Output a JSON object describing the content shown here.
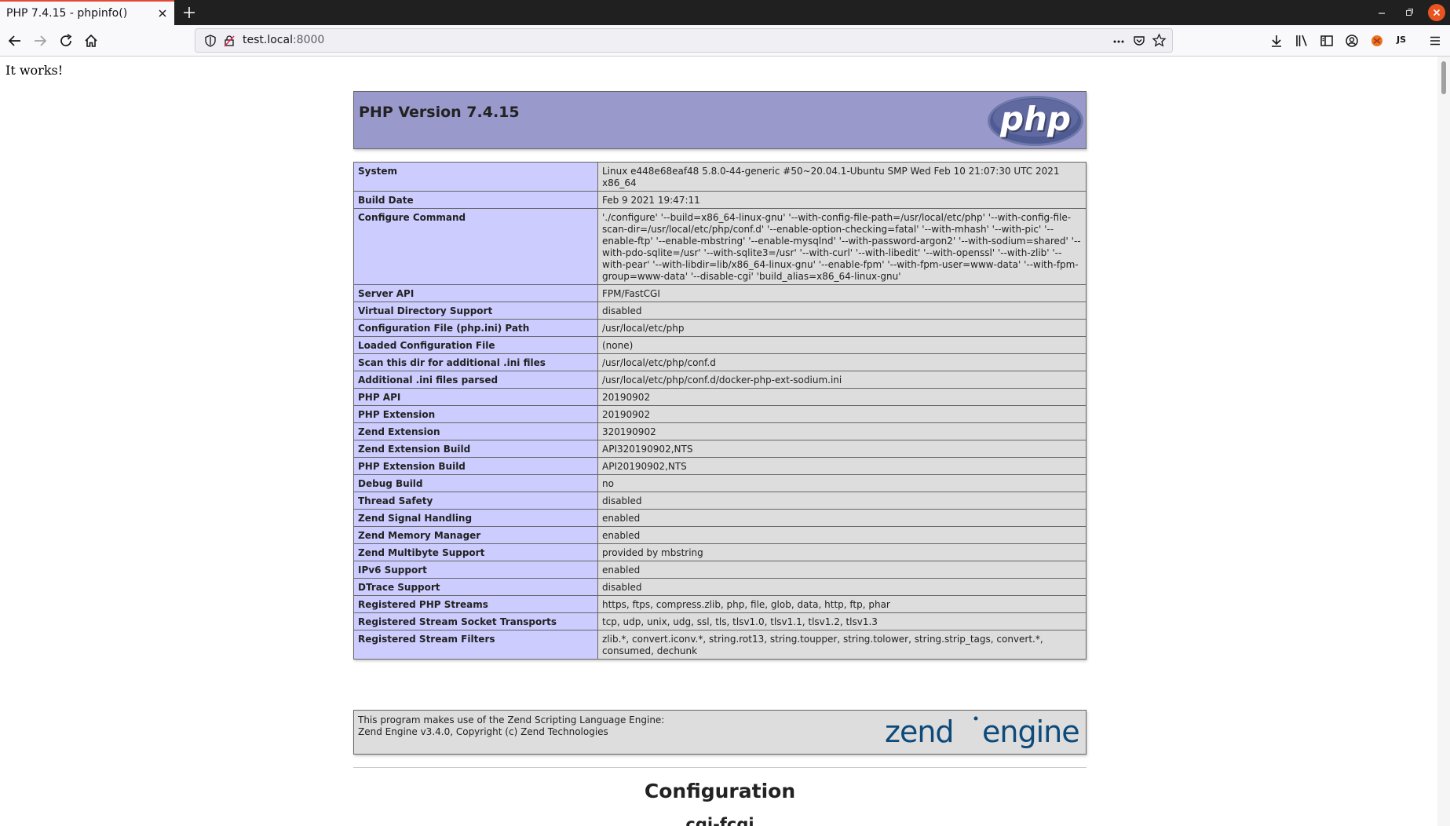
{
  "browser": {
    "tab_title": "PHP 7.4.15 - phpinfo()",
    "url_host": "test.local",
    "url_port": ":8000",
    "extension_badge": "JS",
    "icons": [
      "tab-close-icon",
      "new-tab-icon",
      "minimize-icon",
      "maximize-icon",
      "window-close-icon",
      "back-icon",
      "forward-icon",
      "reload-icon",
      "home-icon",
      "shield-icon",
      "insecure-icon",
      "page-actions-icon",
      "pocket-icon",
      "bookmark-star-icon",
      "downloads-icon",
      "library-icon",
      "sidebar-icon",
      "account-icon",
      "extension-icon",
      "menu-icon"
    ],
    "accent_color": "#e34a35"
  },
  "page": {
    "intro": "It works!",
    "header_title": "PHP Version 7.4.15",
    "colors": {
      "header_bg": "#9999cc",
      "label_bg": "#ccccff",
      "value_bg": "#dddddd"
    },
    "rows": [
      {
        "label": "System",
        "value": "Linux e448e68eaf48 5.8.0-44-generic #50~20.04.1-Ubuntu SMP Wed Feb 10 21:07:30 UTC 2021 x86_64"
      },
      {
        "label": "Build Date",
        "value": "Feb 9 2021 19:47:11"
      },
      {
        "label": "Configure Command",
        "value": "'./configure' '--build=x86_64-linux-gnu' '--with-config-file-path=/usr/local/etc/php' '--with-config-file-scan-dir=/usr/local/etc/php/conf.d' '--enable-option-checking=fatal' '--with-mhash' '--with-pic' '--enable-ftp' '--enable-mbstring' '--enable-mysqlnd' '--with-password-argon2' '--with-sodium=shared' '--with-pdo-sqlite=/usr' '--with-sqlite3=/usr' '--with-curl' '--with-libedit' '--with-openssl' '--with-zlib' '--with-pear' '--with-libdir=lib/x86_64-linux-gnu' '--enable-fpm' '--with-fpm-user=www-data' '--with-fpm-group=www-data' '--disable-cgi' 'build_alias=x86_64-linux-gnu'"
      },
      {
        "label": "Server API",
        "value": "FPM/FastCGI"
      },
      {
        "label": "Virtual Directory Support",
        "value": "disabled"
      },
      {
        "label": "Configuration File (php.ini) Path",
        "value": "/usr/local/etc/php"
      },
      {
        "label": "Loaded Configuration File",
        "value": "(none)"
      },
      {
        "label": "Scan this dir for additional .ini files",
        "value": "/usr/local/etc/php/conf.d"
      },
      {
        "label": "Additional .ini files parsed",
        "value": "/usr/local/etc/php/conf.d/docker-php-ext-sodium.ini"
      },
      {
        "label": "PHP API",
        "value": "20190902"
      },
      {
        "label": "PHP Extension",
        "value": "20190902"
      },
      {
        "label": "Zend Extension",
        "value": "320190902"
      },
      {
        "label": "Zend Extension Build",
        "value": "API320190902,NTS"
      },
      {
        "label": "PHP Extension Build",
        "value": "API20190902,NTS"
      },
      {
        "label": "Debug Build",
        "value": "no"
      },
      {
        "label": "Thread Safety",
        "value": "disabled"
      },
      {
        "label": "Zend Signal Handling",
        "value": "enabled"
      },
      {
        "label": "Zend Memory Manager",
        "value": "enabled"
      },
      {
        "label": "Zend Multibyte Support",
        "value": "provided by mbstring"
      },
      {
        "label": "IPv6 Support",
        "value": "enabled"
      },
      {
        "label": "DTrace Support",
        "value": "disabled"
      },
      {
        "label": "Registered PHP Streams",
        "value": "https, ftps, compress.zlib, php, file, glob, data, http, ftp, phar"
      },
      {
        "label": "Registered Stream Socket Transports",
        "value": "tcp, udp, unix, udg, ssl, tls, tlsv1.0, tlsv1.1, tlsv1.2, tlsv1.3"
      },
      {
        "label": "Registered Stream Filters",
        "value": "zlib.*, convert.iconv.*, string.rot13, string.toupper, string.tolower, string.strip_tags, convert.*, consumed, dechunk"
      }
    ],
    "zend_line1": "This program makes use of the Zend Scripting Language Engine:",
    "zend_line2": "Zend Engine v3.4.0, Copyright (c) Zend Technologies",
    "section_title": "Configuration",
    "subsection_title": "cgi-fcgi"
  }
}
